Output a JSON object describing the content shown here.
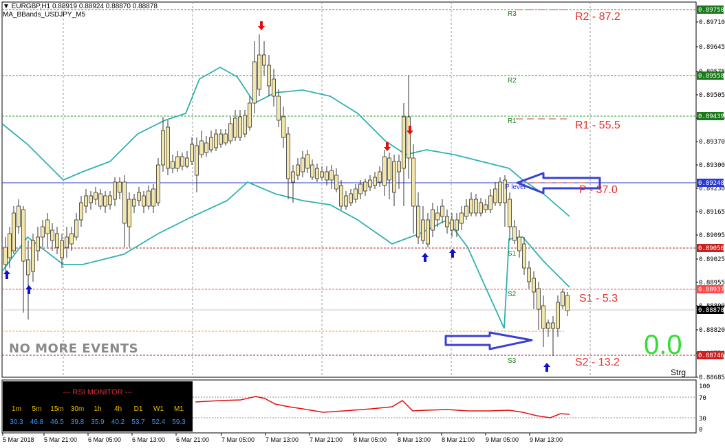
{
  "header": {
    "symbol_line": "▼ EURGBP,H1  0.88919 0.88924 0.88870 0.88878",
    "indicator": "MA_BBands_USDJPY_M5"
  },
  "price_axis": {
    "ticks": [
      "0.89710",
      "0.89645",
      "0.89575",
      "0.89505",
      "0.89440",
      "0.89370",
      "0.89300",
      "0.89230",
      "0.89165",
      "0.89095",
      "0.89025",
      "0.88955",
      "0.88890",
      "0.88820",
      "0.88750",
      "0.88685"
    ],
    "highlights": [
      {
        "label": "0.89750",
        "color": "#1a7a1a"
      },
      {
        "label": "0.89558",
        "color": "#1a7a1a"
      },
      {
        "label": "0.89439",
        "color": "#1a7a1a"
      },
      {
        "label": "0.89248",
        "color": "#2a3ad0"
      },
      {
        "label": "0.89056",
        "color": "#cc2020"
      },
      {
        "label": "0.88937",
        "color": "#ff4a4a"
      },
      {
        "label": "0.88878",
        "color": "#000000"
      },
      {
        "label": "0.88746",
        "color": "#cc2020"
      }
    ]
  },
  "pivot_levels": [
    {
      "name": "R3",
      "value": "R2 - 87.2"
    },
    {
      "name": "R2",
      "value": ""
    },
    {
      "name": "R1",
      "value": "R1 - 55.5"
    },
    {
      "name": "P level",
      "value": "P - 37.0"
    },
    {
      "name": "S1",
      "value": ""
    },
    {
      "name": "S2",
      "value": "S1 - 5.3"
    },
    {
      "name": "S3",
      "value": "S2 - 13.2"
    }
  ],
  "banner": "NO MORE EVENTS",
  "big_value": "0.0",
  "corner_label": "Strg",
  "rsi_monitor": {
    "title": "--- RSI MONITOR ---",
    "timeframes": [
      "1m",
      "5m",
      "15m",
      "30m",
      "1h",
      "4h",
      "D1",
      "W1",
      "M1"
    ],
    "values": [
      "30.3",
      "46.8",
      "46.5",
      "39.8",
      "35.9",
      "40.2",
      "53.7",
      "52.4",
      "59.3"
    ]
  },
  "rsi_axis": [
    "100",
    "70",
    "30",
    "0"
  ],
  "dates": [
    "5 Mar 2018",
    "5 Mar 21:00",
    "6 Mar 05:00",
    "6 Mar 13:00",
    "6 Mar 21:00",
    "7 Mar 05:00",
    "7 Mar 13:00",
    "7 Mar 21:00",
    "8 Mar 05:00",
    "8 Mar 13:00",
    "8 Mar 21:00",
    "9 Mar 05:00",
    "9 Mar 13:00"
  ],
  "colors": {
    "bull": "#f2e6a8",
    "bear": "#333333",
    "band": "#30b0b0",
    "pivot_blue": "#2a3ad0",
    "rsi_line": "#e01010",
    "arrow_up": "#1010d0",
    "arrow_down": "#e01010"
  }
}
